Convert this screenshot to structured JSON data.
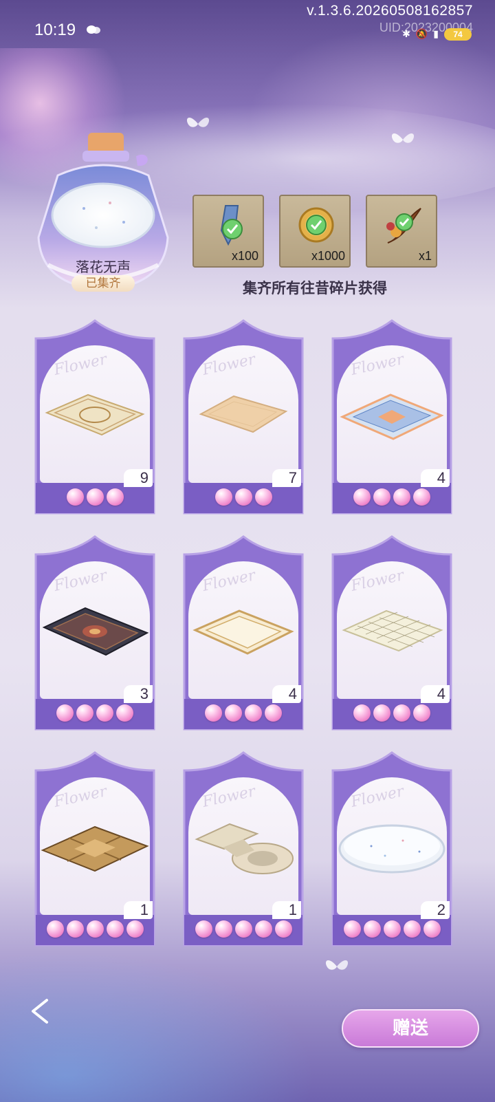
{
  "status_bar": {
    "time": "10:19",
    "version": "v.1.3.6.20260508162857",
    "uid": "UID:2023200004",
    "battery": "74"
  },
  "collection": {
    "title": "落花无声",
    "status": "已集齐"
  },
  "rewards": [
    {
      "icon": "blue-crystal-icon",
      "quantity": "x100"
    },
    {
      "icon": "gold-clover-coin-icon",
      "quantity": "x1000"
    },
    {
      "icon": "cornucopia-icon",
      "quantity": "x1"
    }
  ],
  "rewards_caption": "集齐所有往昔碎片获得",
  "cards": [
    {
      "item": "ornate-cream-rug",
      "count": "9",
      "pearls": 3
    },
    {
      "item": "plain-beige-rug",
      "count": "7",
      "pearls": 3
    },
    {
      "item": "blue-tile-pattern-rug",
      "count": "4",
      "pearls": 4
    },
    {
      "item": "persian-dark-rug",
      "count": "3",
      "pearls": 4
    },
    {
      "item": "gold-border-rug",
      "count": "4",
      "pearls": 4
    },
    {
      "item": "grid-cream-rug",
      "count": "4",
      "pearls": 4
    },
    {
      "item": "wooden-floor-panel",
      "count": "1",
      "pearls": 5
    },
    {
      "item": "stone-path-floor",
      "count": "1",
      "pearls": 5
    },
    {
      "item": "round-speckled-rug",
      "count": "2",
      "pearls": 5
    }
  ],
  "card_watermark": "Flower",
  "gift_button": "赠送",
  "colors": {
    "card_frame": "#8b6fd0",
    "pearl": "#f088cc",
    "gift_button": "#d48ade"
  }
}
